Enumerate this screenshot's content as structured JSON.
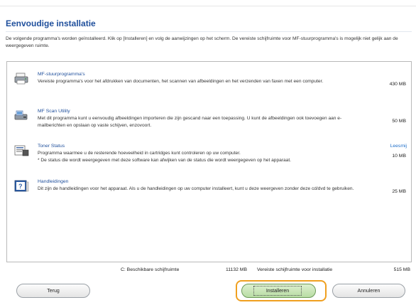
{
  "title": "Eenvoudige installatie",
  "intro": "De volgende programma's worden geïnstalleerd. Klik op [Installeren] en volg de aanwijzingen op het scherm. De vereiste schijfruimte voor MF-stuurprogramma's is mogelijk niet gelijk aan de weergegeven ruimte.",
  "items": [
    {
      "name": "MF-stuurprogramma's",
      "description": "Vereiste programma's voor het afdrukken van documenten, het scannen van afbeeldingen en het verzenden van faxen met een computer.",
      "size": "430 MB",
      "icon": "printer-icon"
    },
    {
      "name": "MF Scan Utility",
      "description": "Met dit programma kunt u eenvoudig afbeeldingen importeren die zijn gescand naar een toepassing. U kunt de afbeeldingen ook toevoegen aan e-mailberichten en opslaan op vaste schijven, enzovoort.",
      "size": "50 MB",
      "icon": "scanner-icon"
    },
    {
      "name": "Toner Status",
      "description": "Programma waarmee u de resterende hoeveelheid in cartridges kunt controleren op uw computer.",
      "note": "* De status die wordt weergegeven met deze software kan afwijken van de status die wordt weergegeven op het apparaat.",
      "extra": "Leesmij",
      "size": "10 MB",
      "icon": "toner-icon"
    },
    {
      "name": "Handleidingen",
      "description": "Dit zijn de handleidingen voor het apparaat. Als u de handleidingen op uw computer installeert, kunt u deze weergeven zonder deze cd/dvd te gebruiken.",
      "size": "25 MB",
      "icon": "manual-book-icon"
    }
  ],
  "footer": {
    "available_label": "C: Beschikbare schijfruimte",
    "available_value": "11132 MB",
    "required_label": "Vereiste schijfruimte voor installatie",
    "required_value": "515 MB"
  },
  "buttons": {
    "back": "Terug",
    "install": "Installeren",
    "cancel": "Annuleren"
  }
}
